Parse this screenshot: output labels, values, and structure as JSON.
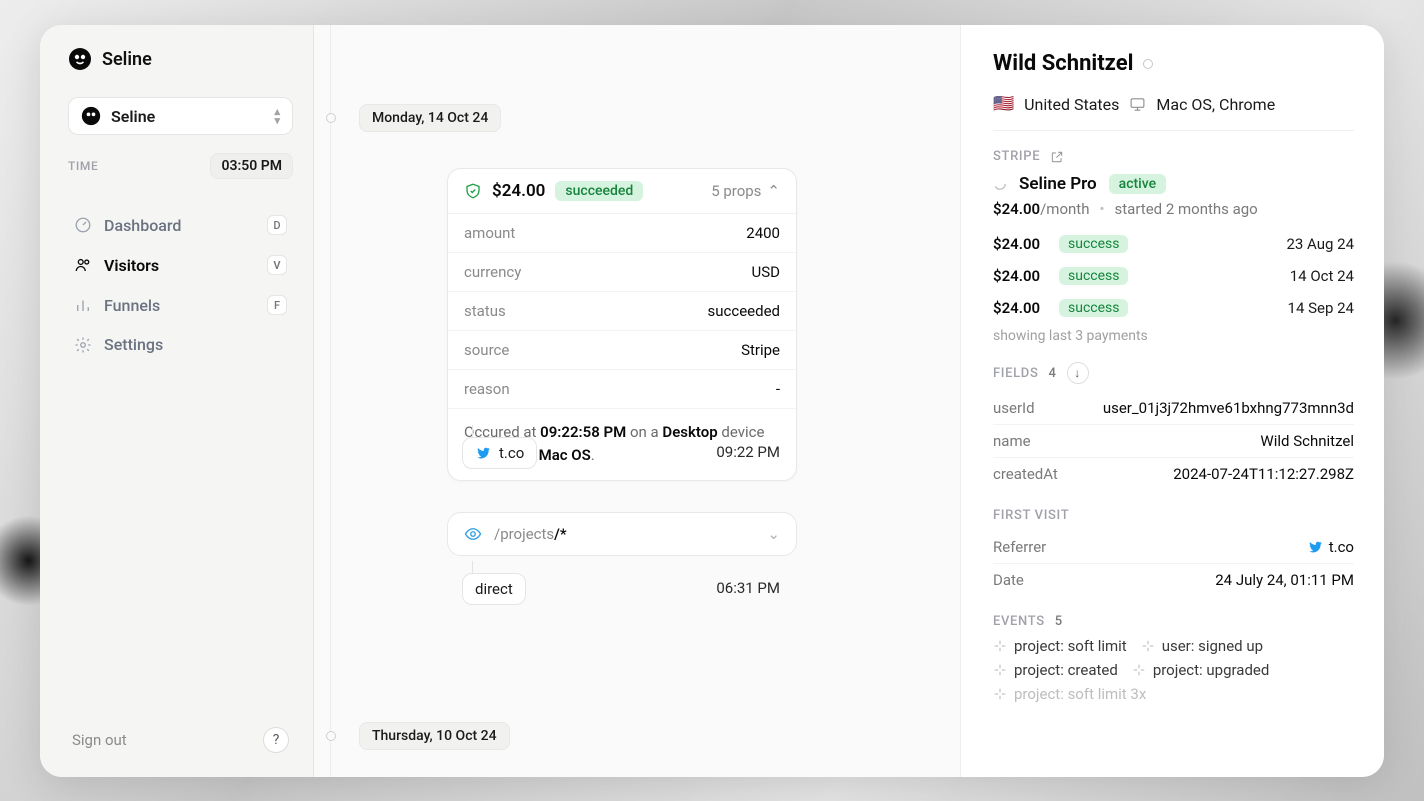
{
  "brand": "Seline",
  "account": {
    "name": "Seline"
  },
  "timeLabel": "TIME",
  "timeValue": "03:50 PM",
  "nav": {
    "dashboard": {
      "label": "Dashboard",
      "kbd": "D"
    },
    "visitors": {
      "label": "Visitors",
      "kbd": "V"
    },
    "funnels": {
      "label": "Funnels",
      "kbd": "F"
    },
    "settings": {
      "label": "Settings"
    }
  },
  "signOut": "Sign out",
  "help": "?",
  "timeline": {
    "day1": "Monday, 14 Oct 24",
    "day2": "Thursday, 10 Oct 24",
    "chargeCard": {
      "amount": "$24.00",
      "status": "succeeded",
      "propsCount": "5 props",
      "kv": {
        "amount_k": "amount",
        "amount_v": "2400",
        "currency_k": "currency",
        "currency_v": "USD",
        "status_k": "status",
        "status_v": "succeeded",
        "source_k": "source",
        "source_v": "Stripe",
        "reason_k": "reason",
        "reason_v": "-"
      },
      "occurred_prefix": "Occured at ",
      "occurred_time": "09:22:58 PM",
      "occurred_mid": " on a ",
      "occurred_device": "Desktop",
      "occurred_mid2": " device running on ",
      "occurred_os": "Mac OS",
      "occurred_suffix": "."
    },
    "ref1": {
      "label": "t.co",
      "time": "09:22 PM"
    },
    "page1": {
      "path_prefix": "/projects",
      "path_suffix": "/*"
    },
    "ref2": {
      "label": "direct",
      "time": "06:31 PM"
    }
  },
  "details": {
    "title": "Wild Schnitzel",
    "country": "United States",
    "os_browser": "Mac OS, Chrome",
    "stripe": {
      "section": "STRIPE",
      "plan": "Seline Pro",
      "planStatus": "active",
      "price": "$24.00",
      "per": "/month",
      "started": "started 2 months ago",
      "paymentsNote": "showing last 3 payments",
      "payments": [
        {
          "amount": "$24.00",
          "status": "success",
          "date": "23 Aug 24"
        },
        {
          "amount": "$24.00",
          "status": "success",
          "date": "14 Oct 24"
        },
        {
          "amount": "$24.00",
          "status": "success",
          "date": "14 Sep 24"
        }
      ]
    },
    "fields": {
      "section": "FIELDS",
      "count": "4",
      "userId_k": "userId",
      "userId_v": "user_01j3j72hmve61bxhng773mnn3d",
      "name_k": "name",
      "name_v": "Wild Schnitzel",
      "createdAt_k": "createdAt",
      "createdAt_v": "2024-07-24T11:12:27.298Z"
    },
    "firstVisit": {
      "section": "FIRST VISIT",
      "ref_k": "Referrer",
      "ref_v": "t.co",
      "date_k": "Date",
      "date_v": "24 July 24, 01:11 PM"
    },
    "events": {
      "section": "EVENTS",
      "count": "5",
      "items": {
        "e1": "project: soft limit",
        "e2": "user: signed up",
        "e3": "project: created",
        "e4": "project: upgraded",
        "e5": "project: soft limit 3x"
      }
    }
  }
}
